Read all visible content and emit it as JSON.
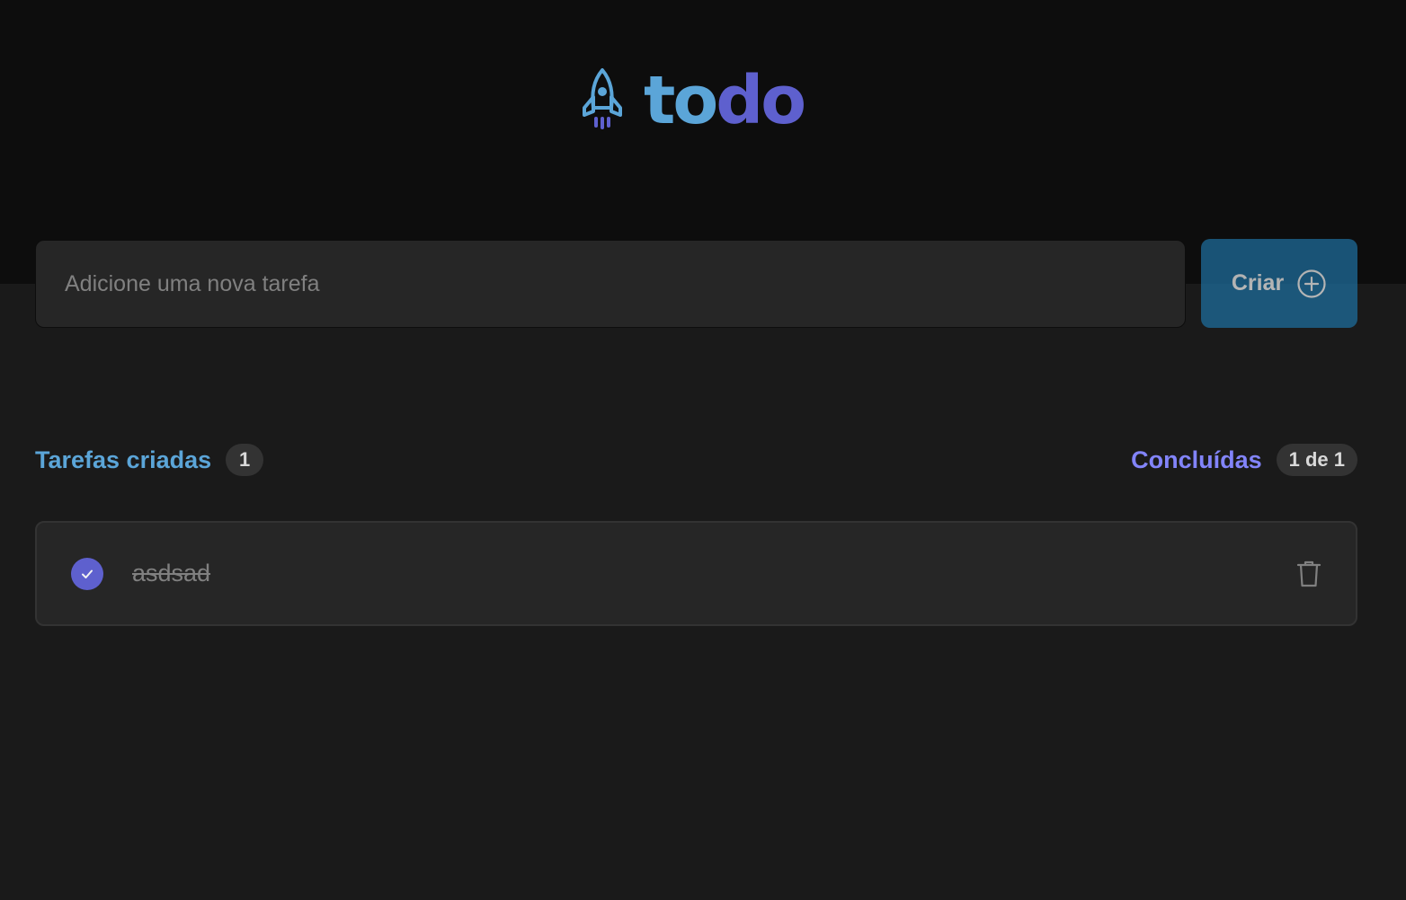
{
  "colors": {
    "blue": "#5ba5d8",
    "purple": "#8284fa",
    "purple_dark": "#5e60ce",
    "button": "#1e6f9f",
    "header_bg": "#0d0d0d",
    "page_bg": "#1a1a1a"
  },
  "header": {
    "logo_icon": "rocket-icon",
    "logo_text_part1": "to",
    "logo_text_part2": "do"
  },
  "new_task": {
    "placeholder": "Adicione uma nova tarefa",
    "value": ""
  },
  "create_button": {
    "label": "Criar",
    "icon": "plus-circle-icon"
  },
  "stats": {
    "created_label": "Tarefas criadas",
    "created_count": "1",
    "done_label": "Concluídas",
    "done_count": "1 de 1"
  },
  "tasks": [
    {
      "text": "asdsad",
      "completed": true,
      "check_icon": "check-icon",
      "delete_icon": "trash-icon"
    }
  ]
}
